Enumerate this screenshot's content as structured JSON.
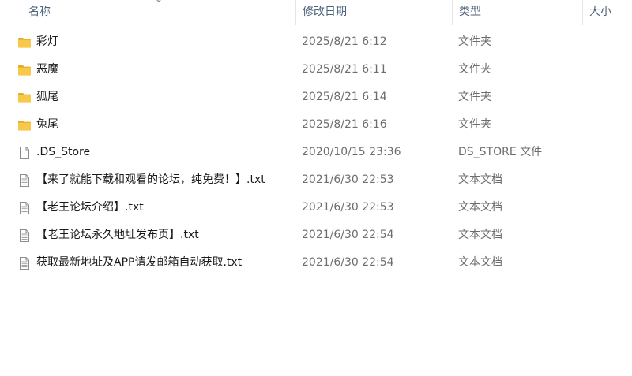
{
  "columns": {
    "name": "名称",
    "date": "修改日期",
    "type": "类型",
    "size": "大小"
  },
  "colors": {
    "folder": "#f8c84a",
    "folder_dark": "#e6a925",
    "header_text": "#4c607a",
    "secondary_text": "#6d6d6d"
  },
  "files": [
    {
      "kind": "folder",
      "icon": "folder-icon",
      "name": "彩灯",
      "date": "2025/8/21 6:12",
      "type": "文件夹",
      "size": ""
    },
    {
      "kind": "folder",
      "icon": "folder-icon",
      "name": "恶魔",
      "date": "2025/8/21 6:11",
      "type": "文件夹",
      "size": ""
    },
    {
      "kind": "folder",
      "icon": "folder-icon",
      "name": "狐尾",
      "date": "2025/8/21 6:14",
      "type": "文件夹",
      "size": ""
    },
    {
      "kind": "folder",
      "icon": "folder-icon",
      "name": "兔尾",
      "date": "2025/8/21 6:16",
      "type": "文件夹",
      "size": ""
    },
    {
      "kind": "file",
      "icon": "blank-file-icon",
      "name": ".DS_Store",
      "date": "2020/10/15 23:36",
      "type": "DS_STORE 文件",
      "size": ""
    },
    {
      "kind": "text",
      "icon": "text-file-icon",
      "name": "【来了就能下载和观看的论坛，纯免费！】.txt",
      "date": "2021/6/30 22:53",
      "type": "文本文档",
      "size": ""
    },
    {
      "kind": "text",
      "icon": "text-file-icon",
      "name": "【老王论坛介绍】.txt",
      "date": "2021/6/30 22:53",
      "type": "文本文档",
      "size": ""
    },
    {
      "kind": "text",
      "icon": "text-file-icon",
      "name": "【老王论坛永久地址发布页】.txt",
      "date": "2021/6/30 22:54",
      "type": "文本文档",
      "size": ""
    },
    {
      "kind": "text",
      "icon": "text-file-icon",
      "name": "获取最新地址及APP请发邮箱自动获取.txt",
      "date": "2021/6/30 22:54",
      "type": "文本文档",
      "size": ""
    }
  ]
}
